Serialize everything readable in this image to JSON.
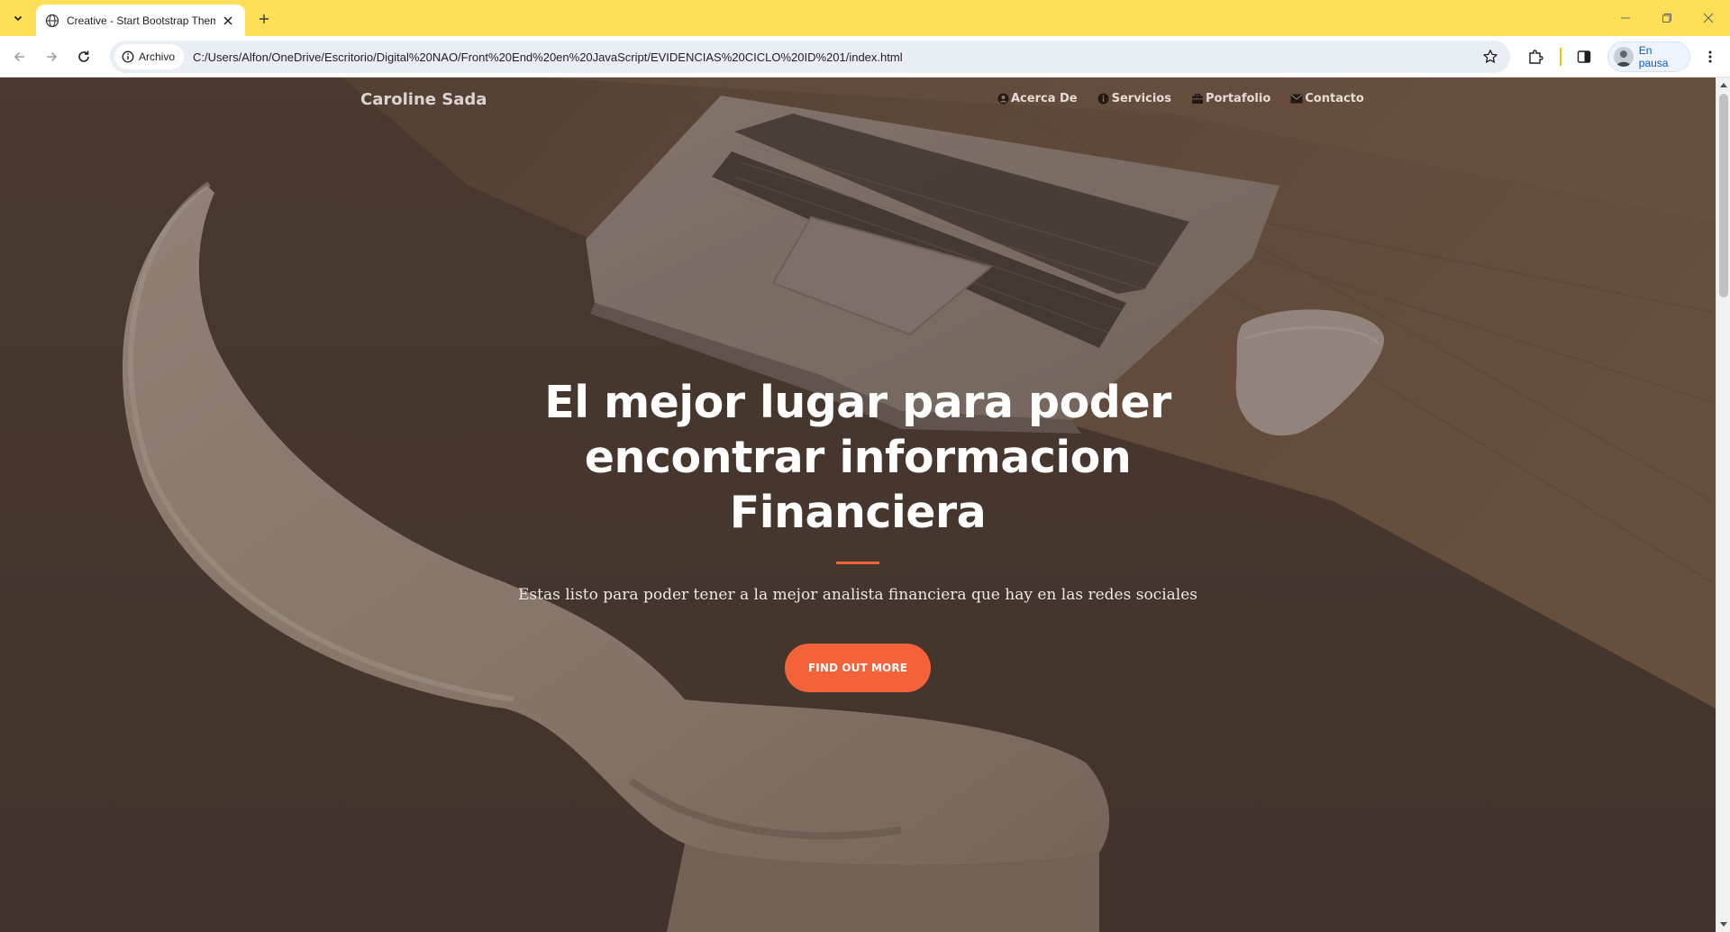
{
  "browser": {
    "tab_title": "Creative - Start Bootstrap Them",
    "site_chip_label": "Archivo",
    "url": "C:/Users/Alfon/OneDrive/Escritorio/Digital%20NAO/Front%20End%20en%20JavaScript/EVIDENCIAS%20CICLO%20ID%201/index.html",
    "profile_label": "En pausa",
    "accent_color": "#fde058"
  },
  "site": {
    "brand": "Caroline Sada",
    "nav": [
      {
        "label": "Acerca De",
        "icon": "user-circle-icon"
      },
      {
        "label": "Servicios",
        "icon": "info-circle-icon"
      },
      {
        "label": "Portafolio",
        "icon": "briefcase-icon"
      },
      {
        "label": "Contacto",
        "icon": "envelope-icon"
      }
    ]
  },
  "hero": {
    "title_line1": "El mejor lugar para poder",
    "title_line2": "encontrar informacion",
    "title_line3": "Financiera",
    "subtitle": "Estas listo para poder tener a la mejor analista financiera que hay en las redes sociales",
    "cta_label": "FIND OUT MORE",
    "accent_color": "#f4623a"
  }
}
